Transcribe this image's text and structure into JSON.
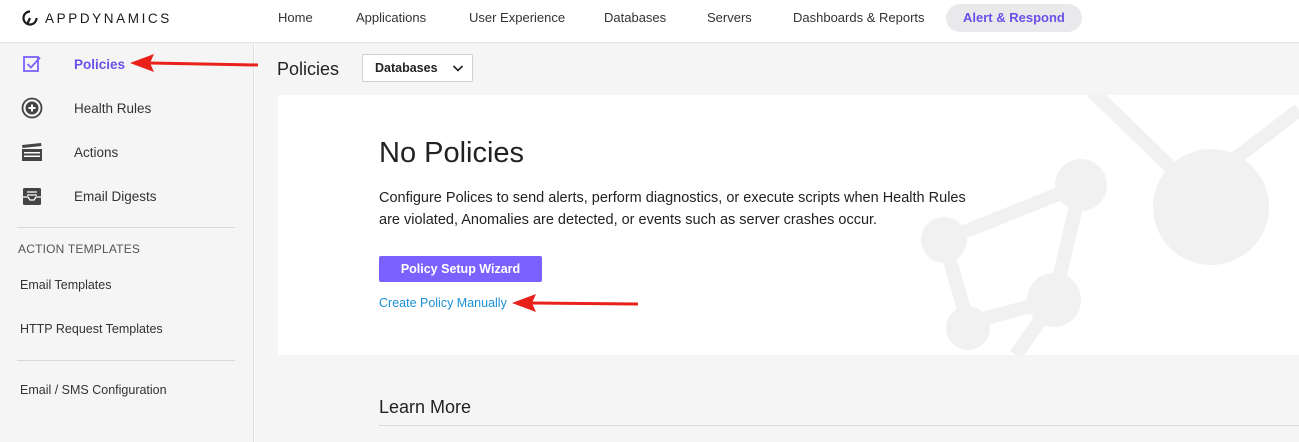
{
  "app": {
    "logo_text": "APPDYNAMICS"
  },
  "nav": {
    "items": [
      {
        "label": "Home",
        "active": false
      },
      {
        "label": "Applications",
        "active": false
      },
      {
        "label": "User Experience",
        "active": false
      },
      {
        "label": "Databases",
        "active": false
      },
      {
        "label": "Servers",
        "active": false
      },
      {
        "label": "Dashboards & Reports",
        "active": false
      },
      {
        "label": "Alert & Respond",
        "active": true
      }
    ]
  },
  "sidebar": {
    "items": [
      {
        "label": "Policies",
        "icon": "checkbox-icon",
        "active": true
      },
      {
        "label": "Health Rules",
        "icon": "plus-circle-icon",
        "active": false
      },
      {
        "label": "Actions",
        "icon": "clapperboard-icon",
        "active": false
      },
      {
        "label": "Email Digests",
        "icon": "inbox-icon",
        "active": false
      }
    ],
    "section_heading": "ACTION TEMPLATES",
    "template_links": [
      "Email Templates",
      "HTTP Request Templates"
    ],
    "config_link": "Email / SMS Configuration"
  },
  "main": {
    "page_title": "Policies",
    "filter_select": {
      "value": "Databases",
      "icon": "chevron-down-icon"
    },
    "empty_state": {
      "title": "No Policies",
      "description": "Configure Polices to send alerts, perform diagnostics, or execute scripts when Health Rules are violated, Anomalies are detected, or events such as server crashes occur.",
      "primary_button": "Policy Setup Wizard",
      "secondary_link": "Create Policy Manually"
    },
    "learn_more_title": "Learn More"
  },
  "colors": {
    "accent": "#7b61ff",
    "active_text": "#6c4fe8",
    "link": "#1a8fd6",
    "annotation_arrow": "#e8221b"
  }
}
